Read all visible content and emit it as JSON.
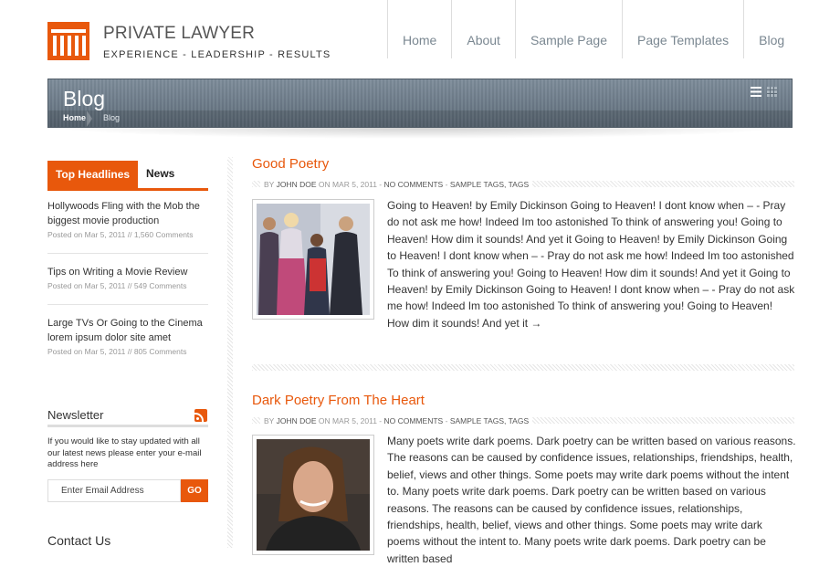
{
  "site": {
    "title": "PRIVATE LAWYER",
    "tagline": "EXPERIENCE  -  LEADERSHIP  -  RESULTS",
    "accent_color": "#e8580c"
  },
  "nav": {
    "items": [
      "Home",
      "About",
      "Sample Page",
      "Page Templates",
      "Blog"
    ]
  },
  "banner": {
    "title": "Blog",
    "breadcrumb_home": "Home",
    "breadcrumb_current": "Blog",
    "view_icons": [
      "list-view-icon",
      "grid-view-icon"
    ]
  },
  "sidebar": {
    "tabs": [
      "Top Headlines",
      "News"
    ],
    "headlines": [
      {
        "title": "Hollywoods Fling with the Mob the biggest movie production",
        "meta": "Posted on Mar 5, 2011 // 1,560 Comments"
      },
      {
        "title": "Tips on Writing a Movie Review",
        "meta": "Posted on Mar 5, 2011 // 549 Comments"
      },
      {
        "title": "Large TVs Or Going to the Cinema lorem ipsum dolor site amet",
        "meta": "Posted on Mar 5, 2011 // 805 Comments"
      }
    ],
    "newsletter": {
      "heading": "Newsletter",
      "text": "If you would like to stay updated with all our latest news please enter your e-mail address here",
      "input_value": "Enter Email Address",
      "button": "GO",
      "icon": "rss-icon"
    },
    "contact_heading": "Contact Us"
  },
  "posts": [
    {
      "title": "Good Poetry",
      "by": "BY",
      "author": "JOHN DOE",
      "on": "ON MAR 5, 2011 -",
      "comments": "NO COMMENTS",
      "sep": "-",
      "tags": "SAMPLE TAGS, TAGS",
      "body": "Going to Heaven! by Emily Dickinson Going to Heaven! I dont know when – - Pray do not ask me how! Indeed Im too astonished To think of answering you! Going to Heaven! How dim it sounds! And yet it Going to Heaven! by Emily Dickinson Going to Heaven! I dont know when – - Pray do not ask me how! Indeed Im too astonished To think of answering you! Going to Heaven! How dim it sounds! And yet it Going to Heaven! by Emily Dickinson Going to Heaven! I dont know when – - Pray do not ask me how! Indeed Im too astonished To think of answering you! Going to Heaven! How dim it sounds! And yet it",
      "read_more": "→"
    },
    {
      "title": "Dark Poetry From The Heart",
      "by": "BY",
      "author": "JOHN DOE",
      "on": "ON MAR 5, 2011 -",
      "comments": "NO COMMENTS",
      "sep": "-",
      "tags": "SAMPLE TAGS, TAGS",
      "body": "Many poets write dark poems. Dark poetry can be written based on various reasons. The reasons can be caused by confidence issues, relationships, friendships, health, belief, views and other things. Some poets may write dark poems without the intent to. Many poets write dark poems. Dark poetry can be written based on various reasons. The reasons can be caused by confidence issues, relationships, friendships, health, belief, views and other things. Some poets may write dark poems without the intent to. Many poets write dark poems. Dark poetry can be written based"
    }
  ]
}
